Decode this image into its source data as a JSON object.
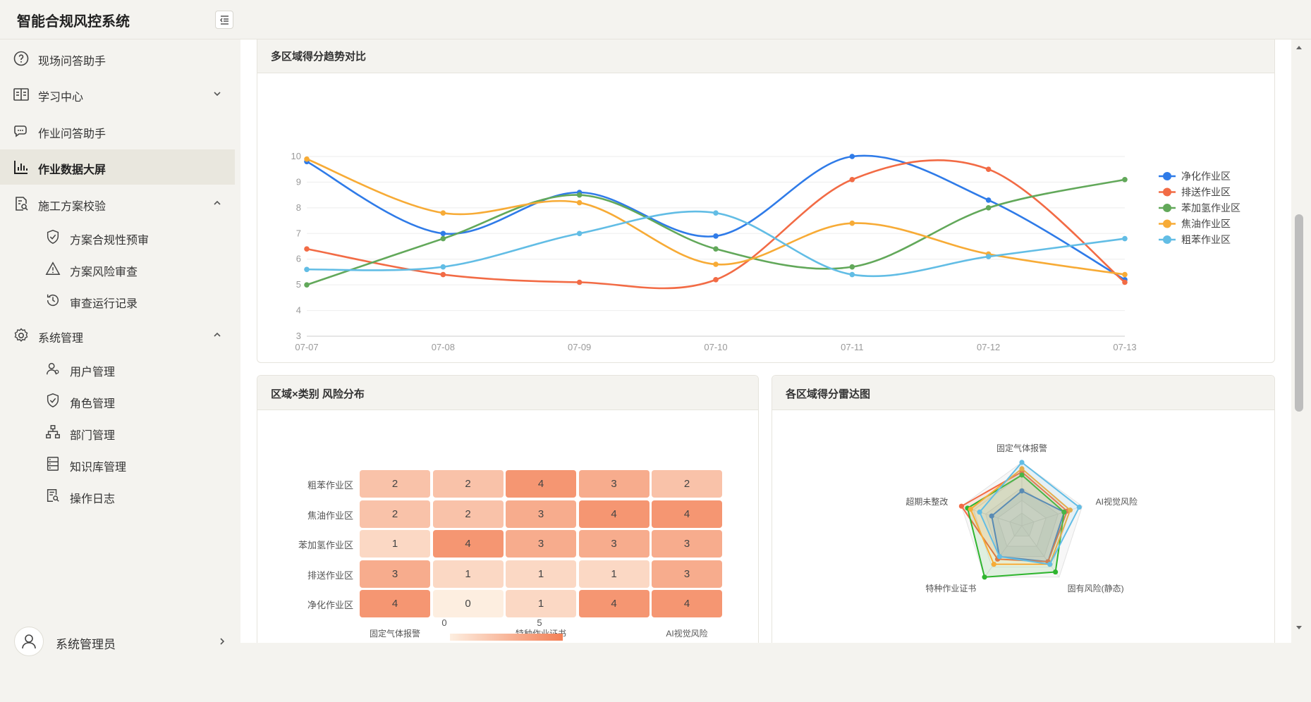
{
  "app": {
    "title": "智能合规风控系统"
  },
  "sidebar": {
    "items": [
      {
        "label": "现场问答助手",
        "icon": "question-circle-icon"
      },
      {
        "label": "学习中心",
        "icon": "book-icon"
      },
      {
        "label": "作业问答助手",
        "icon": "chat-icon"
      },
      {
        "label": "作业数据大屏",
        "icon": "bar-chart-icon",
        "active": true
      },
      {
        "label": "施工方案校验",
        "icon": "doc-search-icon"
      },
      {
        "label": "系统管理",
        "icon": "gear-icon"
      }
    ],
    "plan_sub": [
      {
        "label": "方案合规性预审",
        "icon": "shield-check-icon"
      },
      {
        "label": "方案风险审查",
        "icon": "warning-icon"
      },
      {
        "label": "审查运行记录",
        "icon": "history-icon"
      }
    ],
    "system_sub": [
      {
        "label": "用户管理",
        "icon": "user-icon"
      },
      {
        "label": "角色管理",
        "icon": "shield-check-icon"
      },
      {
        "label": "部门管理",
        "icon": "org-chart-icon"
      },
      {
        "label": "知识库管理",
        "icon": "database-icon"
      },
      {
        "label": "操作日志",
        "icon": "log-search-icon"
      }
    ]
  },
  "user": {
    "name": "系统管理员"
  },
  "cards": {
    "trend_title": "多区域得分趋势对比",
    "heatmap_title": "区域×类别 风险分布",
    "radar_title": "各区域得分雷达图"
  },
  "colors": {
    "净化作业区": "#2f7be8",
    "排送作业区": "#f26b45",
    "苯加氢作业区": "#62a85a",
    "焦油作业区": "#f7ab36",
    "粗苯作业区": "#62bde5"
  },
  "chart_data": [
    {
      "type": "line",
      "smooth": true,
      "title": "多区域得分趋势对比",
      "x": [
        "07-07",
        "07-08",
        "07-09",
        "07-10",
        "07-11",
        "07-12",
        "07-13"
      ],
      "ylim": [
        3,
        10
      ],
      "yticks": [
        3,
        4,
        5,
        6,
        7,
        8,
        9,
        10
      ],
      "grid": true,
      "legend": "right",
      "series": [
        {
          "name": "净化作业区",
          "values": [
            9.8,
            7.0,
            8.6,
            6.9,
            10.0,
            8.3,
            5.2
          ]
        },
        {
          "name": "排送作业区",
          "values": [
            6.4,
            5.4,
            5.1,
            5.2,
            9.1,
            9.5,
            5.1
          ]
        },
        {
          "name": "苯加氢作业区",
          "values": [
            5.0,
            6.8,
            8.5,
            6.4,
            5.7,
            8.0,
            9.1
          ]
        },
        {
          "name": "焦油作业区",
          "values": [
            9.9,
            7.8,
            8.2,
            5.8,
            7.4,
            6.2,
            5.4
          ]
        },
        {
          "name": "粗苯作业区",
          "values": [
            5.6,
            5.7,
            7.0,
            7.8,
            5.4,
            6.1,
            6.8
          ]
        }
      ]
    },
    {
      "type": "heatmap",
      "title": "区域×类别 风险分布",
      "rows": [
        "粗苯作业区",
        "焦油作业区",
        "苯加氢作业区",
        "排送作业区",
        "净化作业区"
      ],
      "columns": [
        "固定气体报警",
        "",
        "特种作业证书",
        "",
        "AI视觉风险"
      ],
      "values": [
        [
          2,
          2,
          4,
          3,
          2
        ],
        [
          2,
          2,
          3,
          4,
          4
        ],
        [
          1,
          4,
          3,
          3,
          3
        ],
        [
          3,
          1,
          1,
          1,
          3
        ],
        [
          4,
          0,
          1,
          4,
          4
        ]
      ],
      "visual_map": {
        "min": 0,
        "max": 5,
        "min_label": "0",
        "max_label": "5"
      }
    },
    {
      "type": "radar",
      "title": "各区域得分雷达图",
      "indicators": [
        "固定气体报警",
        "AI视觉风险",
        "固有风险(静态)",
        "特种作业证书",
        "超期未整改"
      ],
      "max": 10,
      "series": [
        {
          "name": "净化作业区",
          "values": [
            5.5,
            7.0,
            7.0,
            6.0,
            5.0
          ],
          "color": "#2f7be8"
        },
        {
          "name": "排送作业区",
          "values": [
            8.5,
            7.5,
            7.0,
            6.5,
            10.0
          ],
          "color": "#f26b45"
        },
        {
          "name": "苯加氢作业区",
          "values": [
            8.0,
            7.0,
            9.0,
            10.0,
            9.0
          ],
          "color": "#2fb52f"
        },
        {
          "name": "焦油作业区",
          "values": [
            9.0,
            8.0,
            7.5,
            7.5,
            8.5
          ],
          "color": "#f7ab36"
        },
        {
          "name": "粗苯作业区",
          "values": [
            10.0,
            9.5,
            7.5,
            6.0,
            7.0
          ],
          "color": "#62bde5"
        }
      ]
    }
  ]
}
